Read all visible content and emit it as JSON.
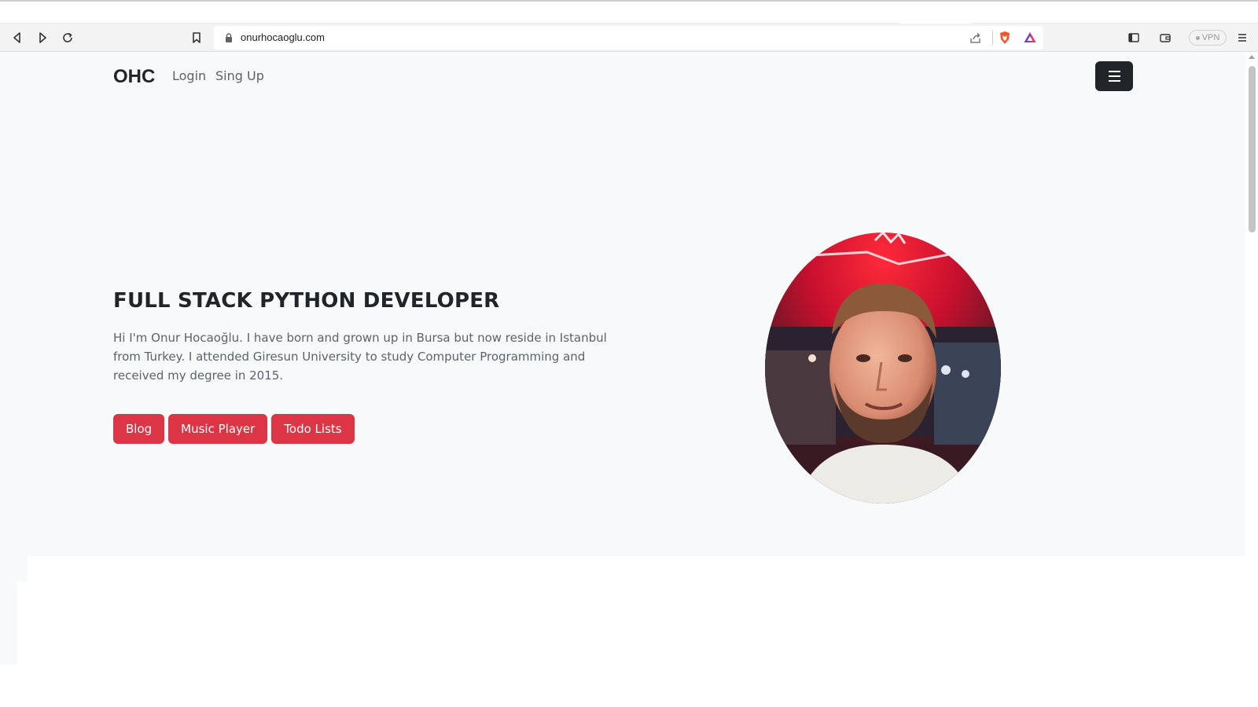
{
  "browser": {
    "url": "onurhocaoglu.com",
    "vpn_label": "VPN",
    "icons": [
      "back-icon",
      "forward-icon",
      "reload-icon",
      "bookmark-icon",
      "lock-icon",
      "share-icon",
      "brave-shield-icon",
      "brave-rewards-icon",
      "sidebar-icon",
      "wallet-icon",
      "menu-icon"
    ]
  },
  "site": {
    "brand": "OHC",
    "nav": {
      "login": "Login",
      "signup": "Sing Up"
    },
    "hero": {
      "title": "FULL STACK PYTHON DEVELOPER",
      "bio": "Hi I'm Onur Hocaoğlu. I have born and grown up in Bursa but now reside in Istanbul from Turkey. I attended Giresun University to study Computer Programming and received my degree in 2015.",
      "buttons": {
        "blog": "Blog",
        "music": "Music Player",
        "todo": "Todo Lists"
      }
    },
    "colors": {
      "accent": "#dc3545",
      "navbar_bg": "#f8f9fa",
      "dark": "#212529"
    }
  }
}
